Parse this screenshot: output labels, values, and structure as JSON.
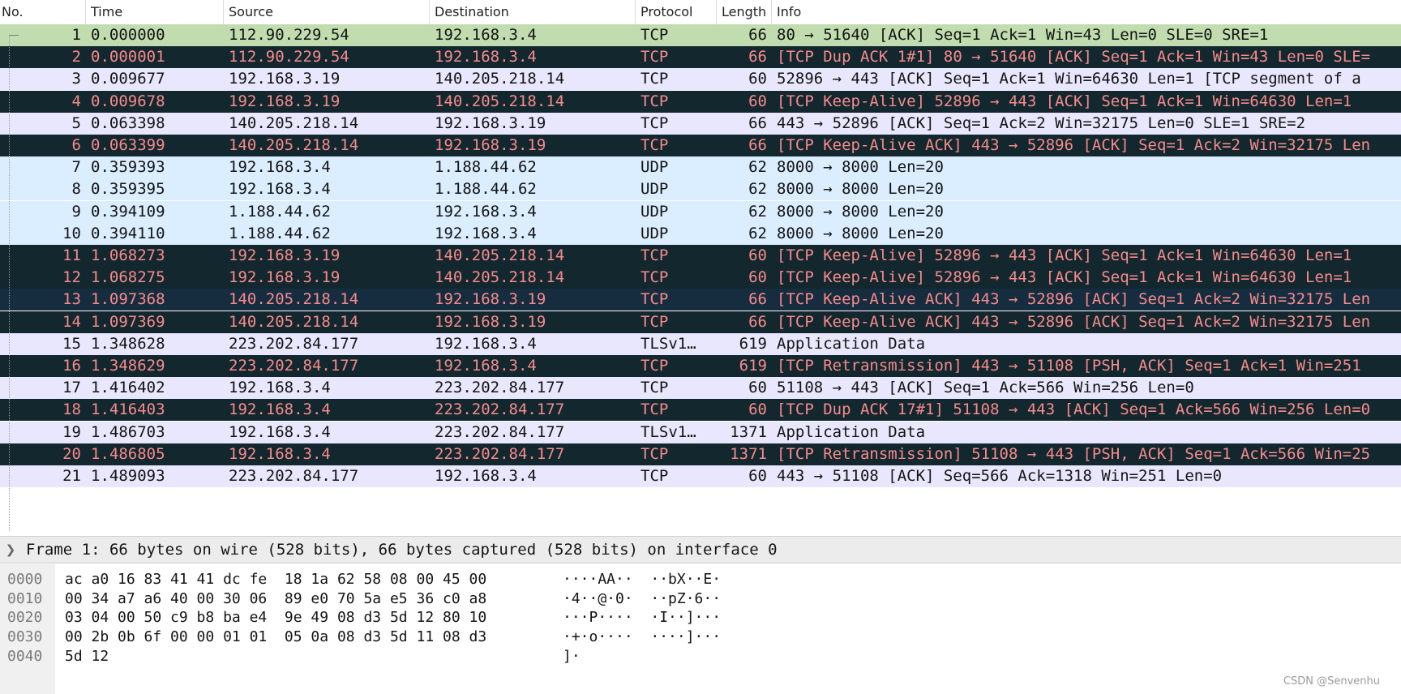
{
  "columns": {
    "no": "No.",
    "time": "Time",
    "source": "Source",
    "destination": "Destination",
    "protocol": "Protocol",
    "length": "Length",
    "info": "Info"
  },
  "packets": [
    {
      "no": "1",
      "time": "0.000000",
      "source": "112.90.229.54",
      "destination": "192.168.3.4",
      "protocol": "TCP",
      "length": "66",
      "info": "80 → 51640 [ACK] Seq=1 Ack=1 Win=43 Len=0 SLE=0 SRE=1",
      "style": "selected"
    },
    {
      "no": "2",
      "time": "0.000001",
      "source": "112.90.229.54",
      "destination": "192.168.3.4",
      "protocol": "TCP",
      "length": "66",
      "info": "[TCP Dup ACK 1#1] 80 → 51640 [ACK] Seq=1 Ack=1 Win=43 Len=0 SLE=",
      "style": "bad"
    },
    {
      "no": "3",
      "time": "0.009677",
      "source": "192.168.3.19",
      "destination": "140.205.218.14",
      "protocol": "TCP",
      "length": "60",
      "info": "52896 → 443 [ACK] Seq=1 Ack=1 Win=64630 Len=1 [TCP segment of a",
      "style": "normal"
    },
    {
      "no": "4",
      "time": "0.009678",
      "source": "192.168.3.19",
      "destination": "140.205.218.14",
      "protocol": "TCP",
      "length": "60",
      "info": "[TCP Keep-Alive] 52896 → 443 [ACK] Seq=1 Ack=1 Win=64630 Len=1",
      "style": "bad"
    },
    {
      "no": "5",
      "time": "0.063398",
      "source": "140.205.218.14",
      "destination": "192.168.3.19",
      "protocol": "TCP",
      "length": "66",
      "info": "443 → 52896 [ACK] Seq=1 Ack=2 Win=32175 Len=0 SLE=1 SRE=2",
      "style": "normal"
    },
    {
      "no": "6",
      "time": "0.063399",
      "source": "140.205.218.14",
      "destination": "192.168.3.19",
      "protocol": "TCP",
      "length": "66",
      "info": "[TCP Keep-Alive ACK] 443 → 52896 [ACK] Seq=1 Ack=2 Win=32175 Len",
      "style": "bad"
    },
    {
      "no": "7",
      "time": "0.359393",
      "source": "192.168.3.4",
      "destination": "1.188.44.62",
      "protocol": "UDP",
      "length": "62",
      "info": "8000 → 8000 Len=20",
      "style": "udp"
    },
    {
      "no": "8",
      "time": "0.359395",
      "source": "192.168.3.4",
      "destination": "1.188.44.62",
      "protocol": "UDP",
      "length": "62",
      "info": "8000 → 8000 Len=20",
      "style": "udp"
    },
    {
      "no": "9",
      "time": "0.394109",
      "source": "1.188.44.62",
      "destination": "192.168.3.4",
      "protocol": "UDP",
      "length": "62",
      "info": "8000 → 8000 Len=20",
      "style": "udp"
    },
    {
      "no": "10",
      "time": "0.394110",
      "source": "1.188.44.62",
      "destination": "192.168.3.4",
      "protocol": "UDP",
      "length": "62",
      "info": "8000 → 8000 Len=20",
      "style": "udp"
    },
    {
      "no": "11",
      "time": "1.068273",
      "source": "192.168.3.19",
      "destination": "140.205.218.14",
      "protocol": "TCP",
      "length": "60",
      "info": "[TCP Keep-Alive] 52896 → 443 [ACK] Seq=1 Ack=1 Win=64630 Len=1",
      "style": "bad"
    },
    {
      "no": "12",
      "time": "1.068275",
      "source": "192.168.3.19",
      "destination": "140.205.218.14",
      "protocol": "TCP",
      "length": "60",
      "info": "[TCP Keep-Alive] 52896 → 443 [ACK] Seq=1 Ack=1 Win=64630 Len=1",
      "style": "bad"
    },
    {
      "no": "13",
      "time": "1.097368",
      "source": "140.205.218.14",
      "destination": "192.168.3.19",
      "protocol": "TCP",
      "length": "66",
      "info": "[TCP Keep-Alive ACK] 443 → 52896 [ACK] Seq=1 Ack=2 Win=32175 Len",
      "style": "badsel"
    },
    {
      "no": "14",
      "time": "1.097369",
      "source": "140.205.218.14",
      "destination": "192.168.3.19",
      "protocol": "TCP",
      "length": "66",
      "info": "[TCP Keep-Alive ACK] 443 → 52896 [ACK] Seq=1 Ack=2 Win=32175 Len",
      "style": "bad"
    },
    {
      "no": "15",
      "time": "1.348628",
      "source": "223.202.84.177",
      "destination": "192.168.3.4",
      "protocol": "TLSv1…",
      "length": "619",
      "info": "Application Data",
      "style": "normal"
    },
    {
      "no": "16",
      "time": "1.348629",
      "source": "223.202.84.177",
      "destination": "192.168.3.4",
      "protocol": "TCP",
      "length": "619",
      "info": "[TCP Retransmission] 443 → 51108 [PSH, ACK] Seq=1 Ack=1 Win=251",
      "style": "bad"
    },
    {
      "no": "17",
      "time": "1.416402",
      "source": "192.168.3.4",
      "destination": "223.202.84.177",
      "protocol": "TCP",
      "length": "60",
      "info": "51108 → 443 [ACK] Seq=1 Ack=566 Win=256 Len=0",
      "style": "normal"
    },
    {
      "no": "18",
      "time": "1.416403",
      "source": "192.168.3.4",
      "destination": "223.202.84.177",
      "protocol": "TCP",
      "length": "60",
      "info": "[TCP Dup ACK 17#1] 51108 → 443 [ACK] Seq=1 Ack=566 Win=256 Len=0",
      "style": "bad"
    },
    {
      "no": "19",
      "time": "1.486703",
      "source": "192.168.3.4",
      "destination": "223.202.84.177",
      "protocol": "TLSv1…",
      "length": "1371",
      "info": "Application Data",
      "style": "normal"
    },
    {
      "no": "20",
      "time": "1.486805",
      "source": "192.168.3.4",
      "destination": "223.202.84.177",
      "protocol": "TCP",
      "length": "1371",
      "info": "[TCP Retransmission] 51108 → 443 [PSH, ACK] Seq=1 Ack=566 Win=25",
      "style": "bad"
    },
    {
      "no": "21",
      "time": "1.489093",
      "source": "223.202.84.177",
      "destination": "192.168.3.4",
      "protocol": "TCP",
      "length": "60",
      "info": "443 → 51108 [ACK] Seq=566 Ack=1318 Win=251 Len=0",
      "style": "normal"
    }
  ],
  "row_styles": {
    "selected": "#c1dcaf",
    "normal": "#e8e7fd",
    "udp": "#daeeff",
    "bad_background": "#12272e",
    "bad_foreground": "#f78b8b"
  },
  "detail": {
    "expand_icon": "chevron-right-icon",
    "frame_summary": "Frame 1: 66 bytes on wire (528 bits), 66 bytes captured (528 bits) on interface 0"
  },
  "bytes": [
    {
      "offset": "0000",
      "hex": "ac a0 16 83 41 41 dc fe  18 1a 62 58 08 00 45 00",
      "ascii": "····AA··  ··bX··E·"
    },
    {
      "offset": "0010",
      "hex": "00 34 a7 a6 40 00 30 06  89 e0 70 5a e5 36 c0 a8",
      "ascii": "·4··@·0·  ··pZ·6··"
    },
    {
      "offset": "0020",
      "hex": "03 04 00 50 c9 b8 ba e4  9e 49 08 d3 5d 12 80 10",
      "ascii": "···P····  ·I··]···"
    },
    {
      "offset": "0030",
      "hex": "00 2b 0b 6f 00 00 01 01  05 0a 08 d3 5d 11 08 d3",
      "ascii": "·+·o····  ····]···"
    },
    {
      "offset": "0040",
      "hex": "5d 12",
      "ascii": "]·"
    }
  ],
  "watermark": "CSDN @Senvenhu"
}
